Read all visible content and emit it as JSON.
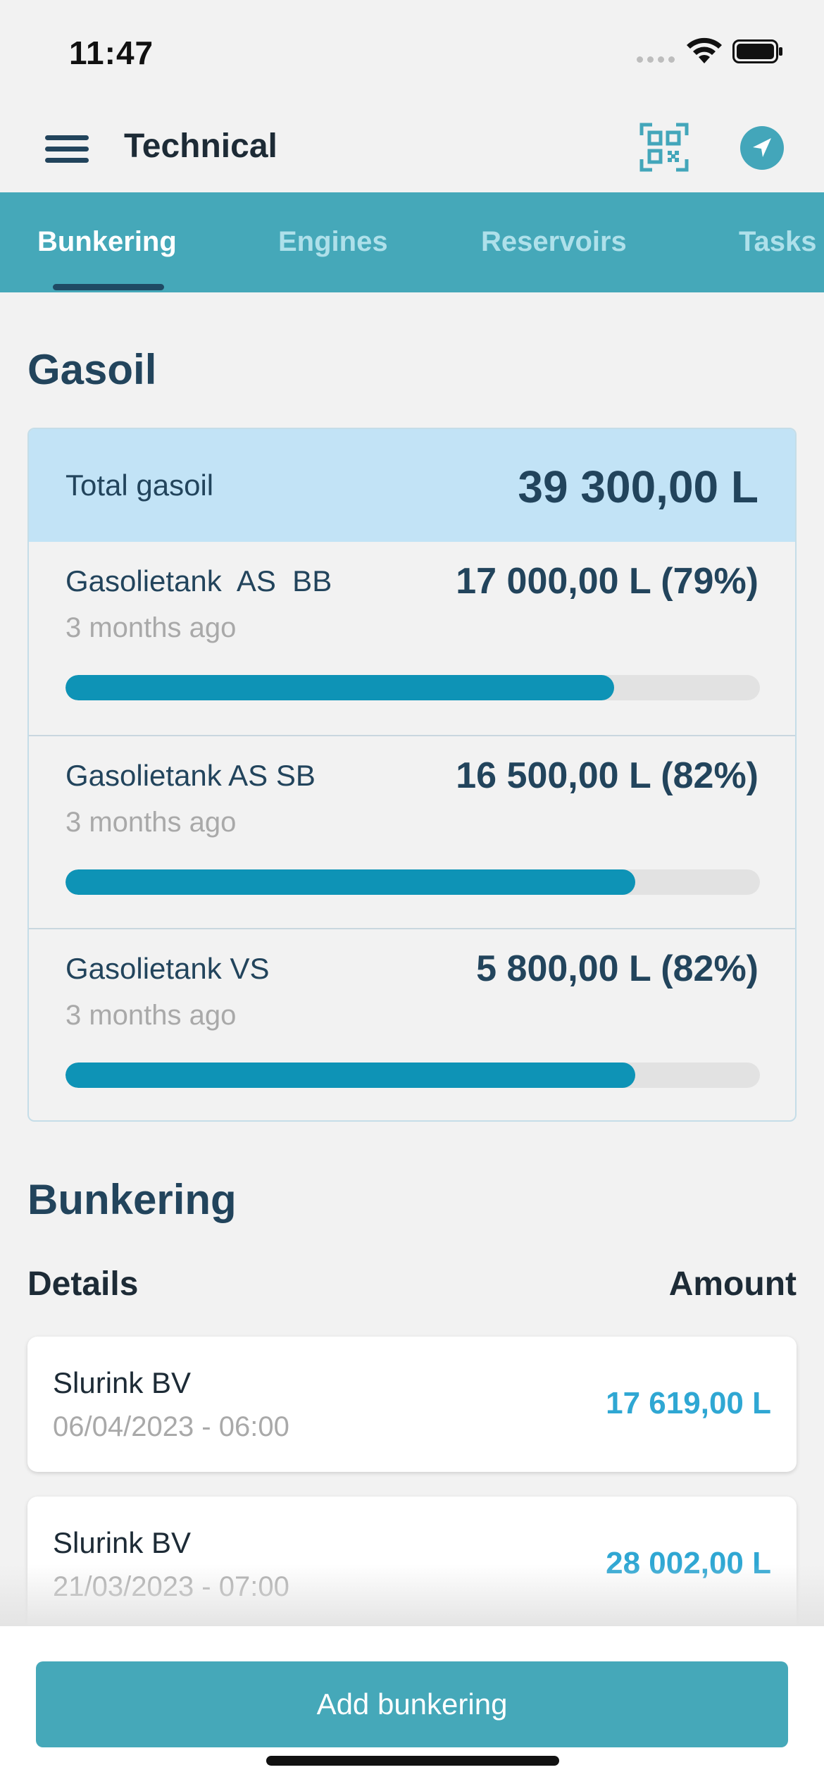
{
  "status_bar": {
    "time": "11:47"
  },
  "header": {
    "title": "Technical",
    "menu_icon": "hamburger-menu-icon",
    "qr_icon": "qr-scan-icon",
    "nav_icon": "location-arrow-icon"
  },
  "tabs": [
    {
      "label": "Bunkering",
      "active": true
    },
    {
      "label": "Engines",
      "active": false
    },
    {
      "label": "Reservoirs",
      "active": false
    },
    {
      "label": "Tasks",
      "active": false
    }
  ],
  "gasoil": {
    "section_title": "Gasoil",
    "total_label": "Total gasoil",
    "total_value": "39 300,00 L",
    "tanks": [
      {
        "name": "Gasolietank  AS  BB",
        "amount": "17 000,00 L (79%)",
        "updated": "3 months ago",
        "fill_percent": 79
      },
      {
        "name": "Gasolietank AS SB",
        "amount": "16 500,00 L (82%)",
        "updated": "3 months ago",
        "fill_percent": 82
      },
      {
        "name": "Gasolietank VS",
        "amount": "5 800,00 L (82%)",
        "updated": "3 months ago",
        "fill_percent": 82
      }
    ]
  },
  "bunkering": {
    "section_title": "Bunkering",
    "details_header": "Details",
    "amount_header": "Amount",
    "entries": [
      {
        "supplier": "Slurink BV",
        "datetime": "06/04/2023 - 06:00",
        "amount": "17 619,00 L"
      },
      {
        "supplier": "Slurink BV",
        "datetime": "21/03/2023 - 07:00",
        "amount": "28 002,00 L"
      }
    ]
  },
  "actions": {
    "add_button_label": "Add bunkering"
  },
  "colors": {
    "primary": "#45a8b9",
    "progress": "#0e93b6",
    "total_bg": "#c2e3f6",
    "amount_text": "#2fa7d3",
    "heading": "#22445c"
  }
}
